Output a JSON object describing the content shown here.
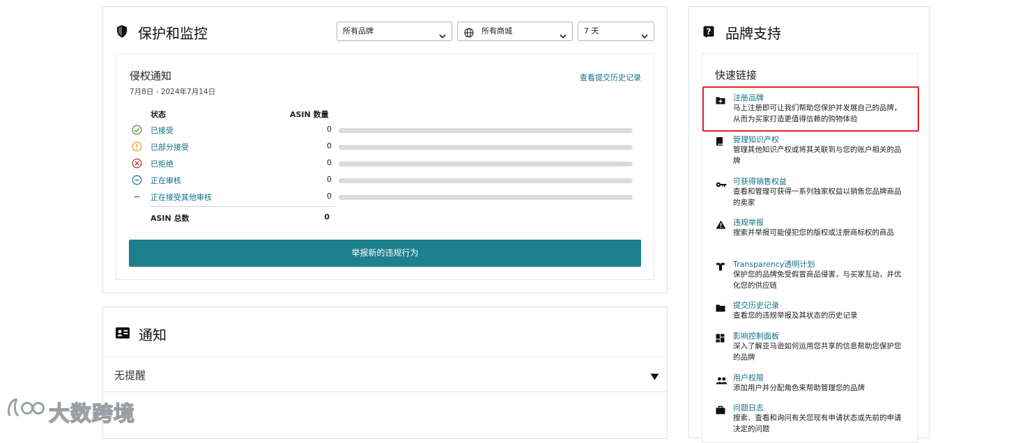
{
  "protect": {
    "title": "保护和监控",
    "filters": {
      "brand": "所有品牌",
      "marketplace": "所有商城",
      "period": "7 天"
    },
    "infringement": {
      "title": "侵权通知",
      "date_range": "7月8日 - 2024年7月14日",
      "history_link": "查看提交历史记录",
      "col_status": "状态",
      "col_count": "ASIN 数量",
      "rows": [
        {
          "icon": "check-circle-icon",
          "label": "已接受",
          "count": "0",
          "color": "#5b8f3c"
        },
        {
          "icon": "warning-circle-icon",
          "label": "已部分接受",
          "count": "0",
          "color": "#e8a317"
        },
        {
          "icon": "x-circle-icon",
          "label": "已拒绝",
          "count": "0",
          "color": "#c7323b"
        },
        {
          "icon": "minus-circle-icon",
          "label": "正在审核",
          "count": "0",
          "color": "#1e7f8d"
        },
        {
          "icon": "dash-icon",
          "label": "正在接受其他审核",
          "count": "0",
          "color": "#1e7f8d"
        }
      ],
      "total_label": "ASIN 总数",
      "total_value": "0",
      "report_button": "举报新的违规行为"
    }
  },
  "notice": {
    "title": "通知",
    "empty": "无提醒"
  },
  "brand": {
    "title": "品牌支持",
    "quick_links_title": "快速链接",
    "links": [
      {
        "icon": "folder-plus-icon",
        "title": "注册品牌",
        "desc": "马上注册即可让我们帮助您保护并发展自己的品牌，从而为买家打造更值得信赖的购物体验"
      },
      {
        "icon": "book-icon",
        "title": "管理知识产权",
        "desc": "管理其他知识产权或将其关联到与您的账户相关的品牌"
      },
      {
        "icon": "key-icon",
        "title": "可获得销售权益",
        "desc": "查看和管理可获得一系列独家权益以销售您品牌商品的卖家"
      },
      {
        "icon": "warning-triangle-icon",
        "title": "违规举报",
        "desc": "搜索并举报可能侵犯您的版权或注册商标权的商品"
      },
      {
        "icon": "transparency-icon",
        "title": "Transparency透明计划",
        "desc": "保护您的品牌免受假冒商品侵害，与买家互动，并优化您的供应链"
      },
      {
        "icon": "folder-icon",
        "title": "提交历史记录",
        "desc": "查看您的违规举报及其状态的历史记录"
      },
      {
        "icon": "dashboard-icon",
        "title": "影响控制面板",
        "desc": "深入了解亚马逊如何运用您共享的信息帮助您保护您的品牌"
      },
      {
        "icon": "users-icon",
        "title": "用户权限",
        "desc": "添加用户并分配角色来帮助管理您的品牌"
      },
      {
        "icon": "briefcase-icon",
        "title": "问题日志",
        "desc": "搜索、查看和询问有关您现有申请状态或先前的申请决定的问题"
      }
    ]
  },
  "watermark": {
    "text": "大数跨境"
  }
}
